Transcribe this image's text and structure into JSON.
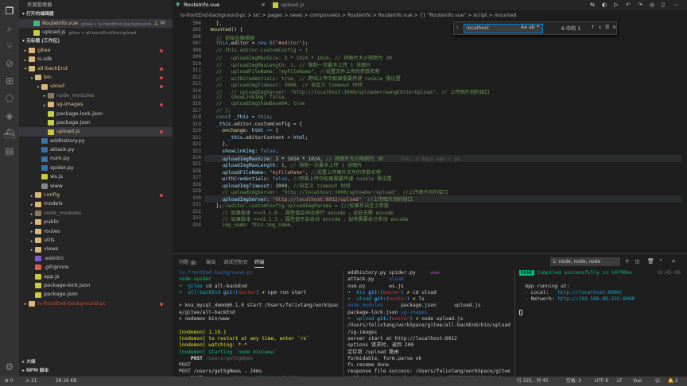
{
  "activity_bar": {
    "icons": [
      "files-icon",
      "search-icon",
      "source-control-icon",
      "debug-icon",
      "extensions-icon",
      "remote-icon",
      "docker-icon",
      "git-icon",
      "database-icon"
    ],
    "bottom_icons": [
      "settings-gear-icon"
    ]
  },
  "sidebar": {
    "title": "资源管理器",
    "open_editors": {
      "header": "打开的编辑器",
      "items": [
        {
          "name": "RouteInfo.vue",
          "detail": "gitee • lv-frontEnd-background-...",
          "badge": "1, M",
          "type": "vue",
          "selected": true
        },
        {
          "name": "upload.js",
          "detail": "gitee • all-backEnd/bin/upload",
          "badge": "",
          "type": "js",
          "selected": false
        }
      ]
    },
    "workspace": {
      "header": "无标题 (工作区)",
      "items": [
        {
          "name": "gitee",
          "depth": 0,
          "arrow": "▸",
          "type": "folder",
          "dot": true
        },
        {
          "name": "is-sdk",
          "depth": 0,
          "arrow": "▸",
          "type": "folder",
          "dot": false
        },
        {
          "name": "all-backEnd",
          "depth": 0,
          "arrow": "▾",
          "type": "folder",
          "dot": true
        },
        {
          "name": "bin",
          "depth": 1,
          "arrow": "▾",
          "type": "folder",
          "dot": true
        },
        {
          "name": "uload",
          "depth": 2,
          "arrow": "▾",
          "type": "folder",
          "dot": true
        },
        {
          "name": "node_modules",
          "depth": 3,
          "arrow": "▸",
          "type": "folder-dim",
          "dot": false
        },
        {
          "name": "sg-images",
          "depth": 3,
          "arrow": "▸",
          "type": "folder",
          "dot": true
        },
        {
          "name": "package-lock.json",
          "depth": 3,
          "arrow": "",
          "type": "json",
          "dot": false
        },
        {
          "name": "package.json",
          "depth": 3,
          "arrow": "",
          "type": "json",
          "dot": false
        },
        {
          "name": "upload.js",
          "depth": 3,
          "arrow": "",
          "type": "js",
          "dot": true,
          "selected": true
        },
        {
          "name": "addhistory.py",
          "depth": 2,
          "arrow": "",
          "type": "py",
          "dot": false
        },
        {
          "name": "attack.py",
          "depth": 2,
          "arrow": "",
          "type": "py",
          "dot": false
        },
        {
          "name": "num.py",
          "depth": 2,
          "arrow": "",
          "type": "py",
          "dot": false
        },
        {
          "name": "spider.py",
          "depth": 2,
          "arrow": "",
          "type": "py",
          "dot": false
        },
        {
          "name": "ws.js",
          "depth": 2,
          "arrow": "",
          "type": "js",
          "dot": false
        },
        {
          "name": "www",
          "depth": 2,
          "arrow": "",
          "type": "plain",
          "dot": false
        },
        {
          "name": "config",
          "depth": 1,
          "arrow": "▸",
          "type": "folder",
          "dot": true
        },
        {
          "name": "models",
          "depth": 1,
          "arrow": "▸",
          "type": "folder",
          "dot": false
        },
        {
          "name": "node_modules",
          "depth": 1,
          "arrow": "▸",
          "type": "folder-dim",
          "dot": false
        },
        {
          "name": "public",
          "depth": 1,
          "arrow": "▸",
          "type": "folder",
          "dot": false
        },
        {
          "name": "routes",
          "depth": 1,
          "arrow": "▸",
          "type": "folder",
          "dot": false
        },
        {
          "name": "utils",
          "depth": 1,
          "arrow": "▸",
          "type": "folder",
          "dot": false
        },
        {
          "name": "views",
          "depth": 1,
          "arrow": "▸",
          "type": "folder",
          "dot": false
        },
        {
          "name": ".eslintrc",
          "depth": 1,
          "arrow": "",
          "type": "eslint",
          "dot": false
        },
        {
          "name": ".gitignore",
          "depth": 1,
          "arrow": "",
          "type": "git",
          "dot": false
        },
        {
          "name": "app.js",
          "depth": 1,
          "arrow": "",
          "type": "js",
          "dot": false
        },
        {
          "name": "package-lock.json",
          "depth": 1,
          "arrow": "",
          "type": "json",
          "dot": false
        },
        {
          "name": "package.json",
          "depth": 1,
          "arrow": "",
          "type": "json",
          "dot": false
        },
        {
          "name": "lv-frontEnd-background-pc",
          "depth": 0,
          "arrow": "▸",
          "type": "folder",
          "dot": true,
          "red": true
        }
      ]
    },
    "outline_header": "大纲",
    "npm_header": "NPM 脚本"
  },
  "tabs": [
    {
      "label": "RouteInfo.vue",
      "active": true,
      "type": "vue"
    },
    {
      "label": "upload.js",
      "active": false,
      "type": "js"
    }
  ],
  "breadcrumb": "lv-frontEnd-background-pc  >  src  >  pages  >  news  >  componnets  >  RouteInfo  >  RouteInfo.vue  >  {} \"RouteInfo.vue\"  >  script  >  mounted",
  "find": {
    "value": "localhost",
    "options": [
      "Aa",
      "ab",
      "*"
    ],
    "count": "6 中的 1"
  },
  "editor": {
    "lines": [
      {
        "n": "304",
        "tokens": [
          [
            "p",
            "    "
          ],
          [
            "p",
            "},"
          ]
        ]
      },
      {
        "n": "305",
        "tokens": [
          [
            "y",
            "  mounted"
          ],
          [
            "p",
            "() {"
          ]
        ]
      },
      {
        "n": "306",
        "tokens": [
          [
            "c",
            "    // 初始化编辑器"
          ]
        ]
      },
      {
        "n": "307",
        "tokens": [
          [
            "k",
            "    this"
          ],
          [
            "p",
            ".editor = "
          ],
          [
            "k",
            "new "
          ],
          [
            "t",
            "E"
          ],
          [
            "p",
            "("
          ],
          [
            "s",
            "\"#editor\""
          ],
          [
            "p",
            ");"
          ]
        ]
      },
      {
        "n": "308",
        "tokens": [
          [
            "c",
            "    // this.editor.customConfig = {"
          ]
        ]
      },
      {
        "n": "309",
        "tokens": [
          [
            "c",
            "    //   uploadImgMaxSize: 3 * 1024 * 1024, // 将图片大小限制为 3M"
          ]
        ]
      },
      {
        "n": "310",
        "tokens": [
          [
            "c",
            "    //   uploadImgMaxLength: 1, // 限制一次最多上传 1 张图片"
          ]
        ]
      },
      {
        "n": "311",
        "tokens": [
          [
            "c",
            "    //   uploadFileName: \"myFileName\", //设置文件上传的参数名称"
          ]
        ]
      },
      {
        "n": "312",
        "tokens": [
          [
            "c",
            "    //   withCredentials: true, // 跨域上传中如果需要传递 cookie 需设置"
          ]
        ]
      },
      {
        "n": "313",
        "tokens": [
          [
            "c",
            "    //   uploadImgTimeout: 3000, // 自定义 timeout 时间"
          ]
        ]
      },
      {
        "n": "314",
        "tokens": [
          [
            "c",
            "    //   // uploadImgServer: \"http://localhost:3000/uploader/wangEditorUpload\", // 上传图片到的接口"
          ]
        ]
      },
      {
        "n": "315",
        "tokens": [
          [
            "c",
            "    //   showLinkImg: false,"
          ]
        ]
      },
      {
        "n": "316",
        "tokens": [
          [
            "c",
            "    //   uploadImgShowBase64: true"
          ]
        ]
      },
      {
        "n": "317",
        "tokens": [
          [
            "c",
            "    // };"
          ]
        ]
      },
      {
        "n": "318",
        "tokens": [
          [
            "k",
            "    const "
          ],
          [
            "v",
            "_this"
          ],
          [
            "p",
            " = "
          ],
          [
            "k",
            "this"
          ],
          [
            "p",
            ";"
          ]
        ]
      },
      {
        "n": "319",
        "tokens": [
          [
            "v",
            "    _this"
          ],
          [
            "p",
            ".editor.customConfig = {"
          ]
        ]
      },
      {
        "n": "320",
        "tokens": [
          [
            "y",
            "      onchange"
          ],
          [
            "p",
            ": "
          ],
          [
            "v",
            "html"
          ],
          [
            "k",
            " => "
          ],
          [
            "p",
            "{"
          ]
        ]
      },
      {
        "n": "321",
        "tokens": [
          [
            "v",
            "        _this"
          ],
          [
            "p",
            ".editorContent = "
          ],
          [
            "v",
            "html"
          ],
          [
            "p",
            ";"
          ]
        ]
      },
      {
        "n": "322",
        "tokens": [
          [
            "p",
            "      },"
          ]
        ]
      },
      {
        "n": "323",
        "tokens": [
          [
            "v",
            "      showLinkImg"
          ],
          [
            "p",
            ": "
          ],
          [
            "k",
            "false"
          ],
          [
            "p",
            ","
          ]
        ]
      },
      {
        "n": "324",
        "tokens": [
          [
            "v",
            "      uploadImgMaxSize"
          ],
          [
            "p",
            ": "
          ],
          [
            "n",
            "3"
          ],
          [
            "p",
            " * "
          ],
          [
            "n",
            "1024"
          ],
          [
            "p",
            " * "
          ],
          [
            "n",
            "1024"
          ],
          [
            "p",
            ", "
          ],
          [
            "c",
            "// 将图片大小限制为 3M"
          ],
          [
            "b",
            "      You, 3 days ago • go"
          ]
        ]
      },
      {
        "n": "325",
        "tokens": [
          [
            "v",
            "      uploadImgMaxLength"
          ],
          [
            "p",
            ": "
          ],
          [
            "n",
            "1"
          ],
          [
            "p",
            ", "
          ],
          [
            "c",
            "// 限制一次最多上传 1 张图片"
          ]
        ]
      },
      {
        "n": "326",
        "tokens": [
          [
            "v",
            "      uploadFileName"
          ],
          [
            "p",
            ": "
          ],
          [
            "s",
            "\"myFileName\""
          ],
          [
            "p",
            ", "
          ],
          [
            "c",
            "//设置上传图片文件的参数名称"
          ]
        ]
      },
      {
        "n": "327",
        "tokens": [
          [
            "v",
            "      withCredentials"
          ],
          [
            "p",
            ": "
          ],
          [
            "k",
            "false"
          ],
          [
            "p",
            ", "
          ],
          [
            "c",
            "//跨域上传中如果需要传递 cookie 需设置"
          ]
        ]
      },
      {
        "n": "328",
        "tokens": [
          [
            "v",
            "      uploadImgTimeout"
          ],
          [
            "p",
            ": "
          ],
          [
            "n",
            "3000"
          ],
          [
            "p",
            ", "
          ],
          [
            "c",
            "//自定义 timeout 时间"
          ]
        ]
      },
      {
        "n": "329",
        "tokens": [
          [
            "c",
            "      // uploadImgServer: \"http://localhost:3000/uploader/upload\", //上传图片到的接口"
          ]
        ]
      },
      {
        "n": "330",
        "tokens": [
          [
            "v",
            "      uploadImgServer"
          ],
          [
            "p",
            ": "
          ],
          [
            "s",
            "\"http://localhost:8012/upload\""
          ],
          [
            "c",
            "  //上传图片到的接口"
          ]
        ]
      },
      {
        "n": "331",
        "tokens": [
          [
            "p",
            "    };"
          ],
          [
            "c",
            "//editor.customConfig.uploadImgParams = {//如果有自定义参数"
          ]
        ]
      },
      {
        "n": "332",
        "tokens": [
          [
            "c",
            "      // 如果版本 <=v3.1.0 ，属性值会自动进行 encode ，此处无需 encode"
          ]
        ]
      },
      {
        "n": "333",
        "tokens": [
          [
            "c",
            "      // 如果版本 >=v3.1.1 ，属性值不会自动 encode ，如有需要自己手动 encode"
          ]
        ]
      },
      {
        "n": "334",
        "tokens": [
          [
            "c",
            "      img_name: this.img_name,"
          ]
        ]
      }
    ]
  },
  "panel": {
    "tabs": [
      "问题",
      "输出",
      "调试控制台",
      "终端"
    ],
    "active_tab": "终端",
    "problems_badge": "1",
    "terminal_select": "1: node, node, node",
    "icons": [
      "add-terminal-icon",
      "split-terminal-icon",
      "trash-icon",
      "maximize-icon",
      "close-icon"
    ],
    "term1": [
      [
        [
          "b",
          "lv-frontEnd-background-pc"
        ]
      ],
      [
        [
          "g",
          "node-spider"
        ]
      ],
      [
        [
          "g",
          "➜  "
        ],
        [
          "c",
          "gitee"
        ],
        [
          "p",
          " cd all-backEnd"
        ]
      ],
      [
        [
          "g",
          "➜  "
        ],
        [
          "c",
          "all-backEnd "
        ],
        [
          "bb",
          "git:("
        ],
        [
          "r",
          "master"
        ],
        [
          "bb",
          ") "
        ],
        [
          "y",
          "✗ "
        ],
        [
          "p",
          "npm run start"
        ]
      ],
      [
        [
          "p",
          ""
        ]
      ],
      [
        [
          "p",
          "> koa_mysql_demo@0.1.0 start /Users/felixtang/workSpac"
        ]
      ],
      [
        [
          "p",
          "e/gitee/all-backEnd"
        ]
      ],
      [
        [
          "p",
          "> nodemon bin/www"
        ]
      ],
      [
        [
          "p",
          ""
        ]
      ],
      [
        [
          "y",
          "[nodemon] 1.19.1"
        ]
      ],
      [
        [
          "y",
          "[nodemon] to restart at any time, enter `rs`"
        ]
      ],
      [
        [
          "y",
          "[nodemon] watching: *.*"
        ]
      ],
      [
        [
          "g",
          "[nodemon] starting `node bin/www`"
        ]
      ],
      [
        [
          "p",
          "    "
        ],
        [
          "w",
          "POST "
        ],
        [
          "d",
          "/users/getSgNews"
        ]
      ],
      [
        [
          "p",
          "POST"
        ]
      ],
      [
        [
          "p",
          "POST /users/getSgNews - 24ms"
        ]
      ],
      [
        [
          "p",
          "    "
        ],
        [
          "w",
          "POST "
        ],
        [
          "d",
          "/users/getSgNews "
        ],
        [
          "g",
          "200 "
        ],
        [
          "d",
          "29ms 2.96kb"
        ]
      ]
    ],
    "term2": [
      [
        [
          "p",
          "addhistory.py spider.py     "
        ],
        [
          "m",
          "www"
        ]
      ],
      [
        [
          "p",
          "attack.py     "
        ],
        [
          "b",
          "uload"
        ]
      ],
      [
        [
          "p",
          "num.py        ws.js"
        ]
      ],
      [
        [
          "g",
          "➜  "
        ],
        [
          "c",
          "bin "
        ],
        [
          "bb",
          "git:("
        ],
        [
          "r",
          "master"
        ],
        [
          "bb",
          ") "
        ],
        [
          "y",
          "✗ "
        ],
        [
          "p",
          "cd uload"
        ]
      ],
      [
        [
          "g",
          "➜  "
        ],
        [
          "c",
          "uload "
        ],
        [
          "bb",
          "git:("
        ],
        [
          "r",
          "master"
        ],
        [
          "bb",
          ") "
        ],
        [
          "y",
          "✗ "
        ],
        [
          "p",
          "ls"
        ]
      ],
      [
        [
          "b",
          "node_modules      "
        ],
        [
          "p",
          "package.json      upload.js"
        ]
      ],
      [
        [
          "p",
          "package-lock.json "
        ],
        [
          "b",
          "sg-images"
        ]
      ],
      [
        [
          "g",
          "➜  "
        ],
        [
          "c",
          "upload "
        ],
        [
          "bb",
          "git:("
        ],
        [
          "r",
          "master"
        ],
        [
          "bb",
          ") "
        ],
        [
          "y",
          "✗ "
        ],
        [
          "p",
          "node upload.js"
        ]
      ],
      [
        [
          "p",
          "/Users/felixtang/workSpace/gitee/all-backEnd/bin/upload"
        ]
      ],
      [
        [
          "p",
          "/sg-images"
        ]
      ],
      [
        [
          "p",
          "server start at http://localhost:8012"
        ]
      ],
      [
        [
          "p",
          "options 请求时, 返回 200"
        ]
      ],
      [
        [
          "p",
          "定位到 /upload 路由"
        ]
      ],
      [
        [
          "p",
          "formidable, form.parse ok"
        ]
      ],
      [
        [
          "p",
          "fs.rename done"
        ]
      ],
      [
        [
          "p",
          "response file success: /Users/felixtang/workSpace/gitee"
        ]
      ],
      [
        [
          "p",
          "/all-backEnd/bin/upload/sg-images/3525921539190484.jpg"
        ]
      ]
    ],
    "term3": {
      "done_badge": "DONE",
      "compiled": "Compiled successfully in 14790ms",
      "time": "18:45:06",
      "running": "App running at:",
      "local_label": "- Local:",
      "local_url": "http://localhost:8080/",
      "network_label": "- Network:",
      "network_url": "http://192.168.88.225:8080"
    }
  },
  "status": {
    "errors": "⊗ 0",
    "warnings": "⚠ 21",
    "size": "28.16 KB",
    "position": "行 325，列 45",
    "spaces": "空格: 2",
    "encoding": "UTF-8",
    "eol": "LF",
    "lang": "Vue",
    "feedback": "☺",
    "bell": "🔔 2"
  },
  "colors": {
    "accent": "#007acc",
    "vue": "#41b883",
    "js": "#cbcb41",
    "json": "#cbcb41",
    "py": "#3572a5",
    "folder": "#dcb67a",
    "modified": "#e2c08d",
    "deleted": "#c74e39"
  }
}
